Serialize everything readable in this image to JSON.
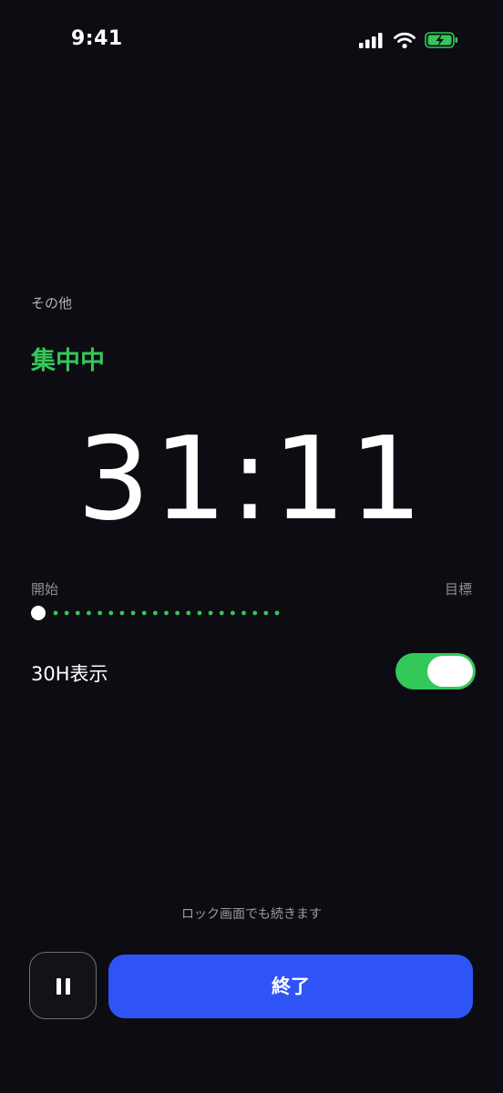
{
  "status_bar": {
    "time": "9:41",
    "icons": [
      "cellular-signal-icon",
      "wifi-icon",
      "battery-charging-icon"
    ]
  },
  "focus": {
    "category": "その他",
    "state": "集中中",
    "timer": "31:11"
  },
  "progress": {
    "start_label": "開始",
    "goal_label": "目標",
    "dot_count": 21,
    "fraction": 0.0
  },
  "display_option": {
    "label": "30H表示",
    "enabled": true
  },
  "footer": {
    "lock_note": "ロック画面でも続きます",
    "pause_icon": "pause-icon",
    "end_label": "終了"
  },
  "colors": {
    "background": "#0c0c12",
    "accent_green": "#34c759",
    "primary_blue": "#2f54f5"
  }
}
